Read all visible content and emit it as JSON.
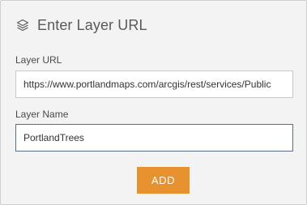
{
  "dialog": {
    "icon": "layers-icon",
    "title": "Enter Layer URL"
  },
  "layer_url": {
    "label": "Layer URL",
    "value": "https://www.portlandmaps.com/arcgis/rest/services/Public"
  },
  "layer_name": {
    "label": "Layer Name",
    "value": "PortlandTrees"
  },
  "actions": {
    "add_label": "ADD"
  },
  "colors": {
    "panel_bg": "#f3f3f3",
    "button_bg": "#e8922f",
    "focus_border": "#5a6e8c"
  }
}
